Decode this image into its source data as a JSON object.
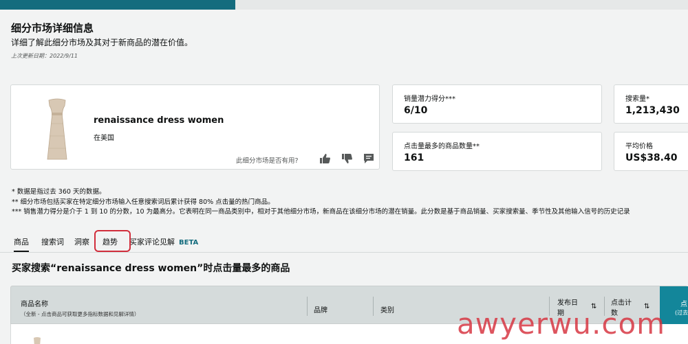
{
  "header": {
    "title": "细分市场详细信息",
    "subtitle": "详细了解此细分市场及其对于新商品的潜在价值。",
    "last_updated": "上次更新日期：2022/9/11"
  },
  "niche": {
    "name": "renaissance dress women",
    "market": "在美国",
    "feedback_question": "此细分市场是否有用?"
  },
  "metrics": {
    "sales_potential": {
      "label": "销量潜力得分***",
      "value": "6/10"
    },
    "search_volume": {
      "label": "搜索量*",
      "value": "1,213,430"
    },
    "top_clicked_count": {
      "label": "点击量最多的商品数量**",
      "value": "161"
    },
    "avg_price": {
      "label": "平均价格",
      "value": "US$38.40"
    }
  },
  "notes": [
    "* 数据是指过去 360 天的数据。",
    "** 细分市场包括买家在特定细分市场输入任意搜索词后累计获得 80% 点击量的热门商品。",
    "*** 销售潜力得分是介于 1 到 10 的分数，10 为最高分。它表明在同一商品类别中，相对于其他细分市场，新商品在该细分市场的潜在销量。此分数是基于商品销量、买家搜索量、季节性及其他输入信号的历史记录"
  ],
  "tabs": [
    {
      "label": "商品"
    },
    {
      "label": "搜索词"
    },
    {
      "label": "洞察"
    },
    {
      "label": "趋势"
    },
    {
      "label": "买家评论见解",
      "badge": "BETA"
    }
  ],
  "section_title": "买家搜索“renaissance dress women”时点击量最多的商品",
  "table": {
    "col_name": "商品名称",
    "col_name_sub": "（全新 - 点击商品可获取更多指标数据和见解详情）",
    "col_brand": "品牌",
    "col_category": "类别",
    "col_date": "发布日期",
    "col_clicks": "点击计数",
    "col_teal_a": "点",
    "col_teal_b": "(过去"
  },
  "watermark": "awyerwu.com",
  "colors": {
    "accent": "#146c7e",
    "highlight": "#d12d3b",
    "teal_header": "#13869a"
  }
}
